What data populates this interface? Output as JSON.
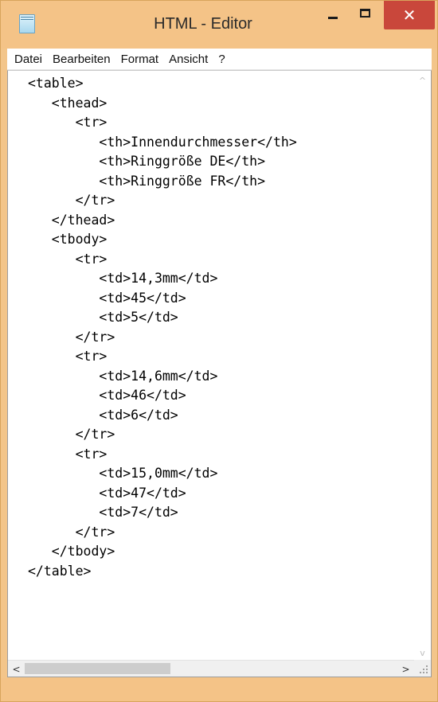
{
  "window": {
    "title": "HTML - Editor",
    "close_glyph": "✕"
  },
  "menu": [
    "Datei",
    "Bearbeiten",
    "Format",
    "Ansicht",
    "?"
  ],
  "editor": {
    "lines": [
      "<table>",
      "   <thead>",
      "      <tr>",
      "         <th>Innendurchmesser</th>",
      "         <th>Ringgröße DE</th>",
      "         <th>Ringgröße FR</th>",
      "      </tr>",
      "   </thead>",
      "   <tbody>",
      "      <tr>",
      "         <td>14,3mm</td>",
      "         <td>45</td>",
      "         <td>5</td>",
      "      </tr>",
      "      <tr>",
      "         <td>14,6mm</td>",
      "         <td>46</td>",
      "         <td>6</td>",
      "      </tr>",
      "      <tr>",
      "         <td>15,0mm</td>",
      "         <td>47</td>",
      "         <td>7</td>",
      "      </tr>",
      "   </tbody>",
      "</table>"
    ]
  },
  "scrollbars": {
    "up_glyph": "^",
    "down_glyph": "v",
    "left_glyph": "<",
    "right_glyph": ">"
  },
  "colors": {
    "title_bar": "#f4c387",
    "close_button": "#c9473b"
  },
  "icons": {
    "app": "notepad-icon",
    "minimize": "minimize-icon",
    "maximize": "maximize-icon",
    "close": "close-icon"
  }
}
